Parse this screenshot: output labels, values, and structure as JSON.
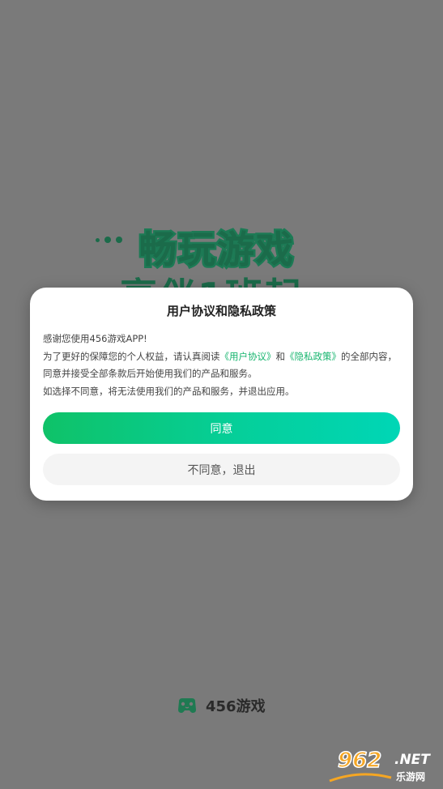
{
  "background": {
    "slogan_line1": "畅玩游戏",
    "slogan_line2": "享伴1班起",
    "slogan_color": "#1b6b4a",
    "overlay_color": "#7a7a7a"
  },
  "dialog": {
    "title": "用户协议和隐私政策",
    "greeting": "感谢您使用456游戏APP!",
    "para1_before": "为了更好的保障您的个人权益，请认真阅读",
    "user_agreement_link": "《用户协议》",
    "and_text": "和",
    "privacy_link": "《隐私政策》",
    "para1_after": "的全部内容，同意并接受全部条款后开始使用我们的产品和服务。",
    "para2": "如选择不同意，将无法使用我们的产品和服务，并退出应用。",
    "agree_label": "同意",
    "disagree_label": "不同意，退出",
    "link_color": "#16b56e",
    "agree_gradient": [
      "#0fc268",
      "#00d6b6"
    ]
  },
  "brand": {
    "logo_icon": "gamepad-logo-icon",
    "name": "456游戏"
  },
  "watermark": {
    "number": "962",
    "suffix": ".NET",
    "subtitle": "乐游网"
  }
}
